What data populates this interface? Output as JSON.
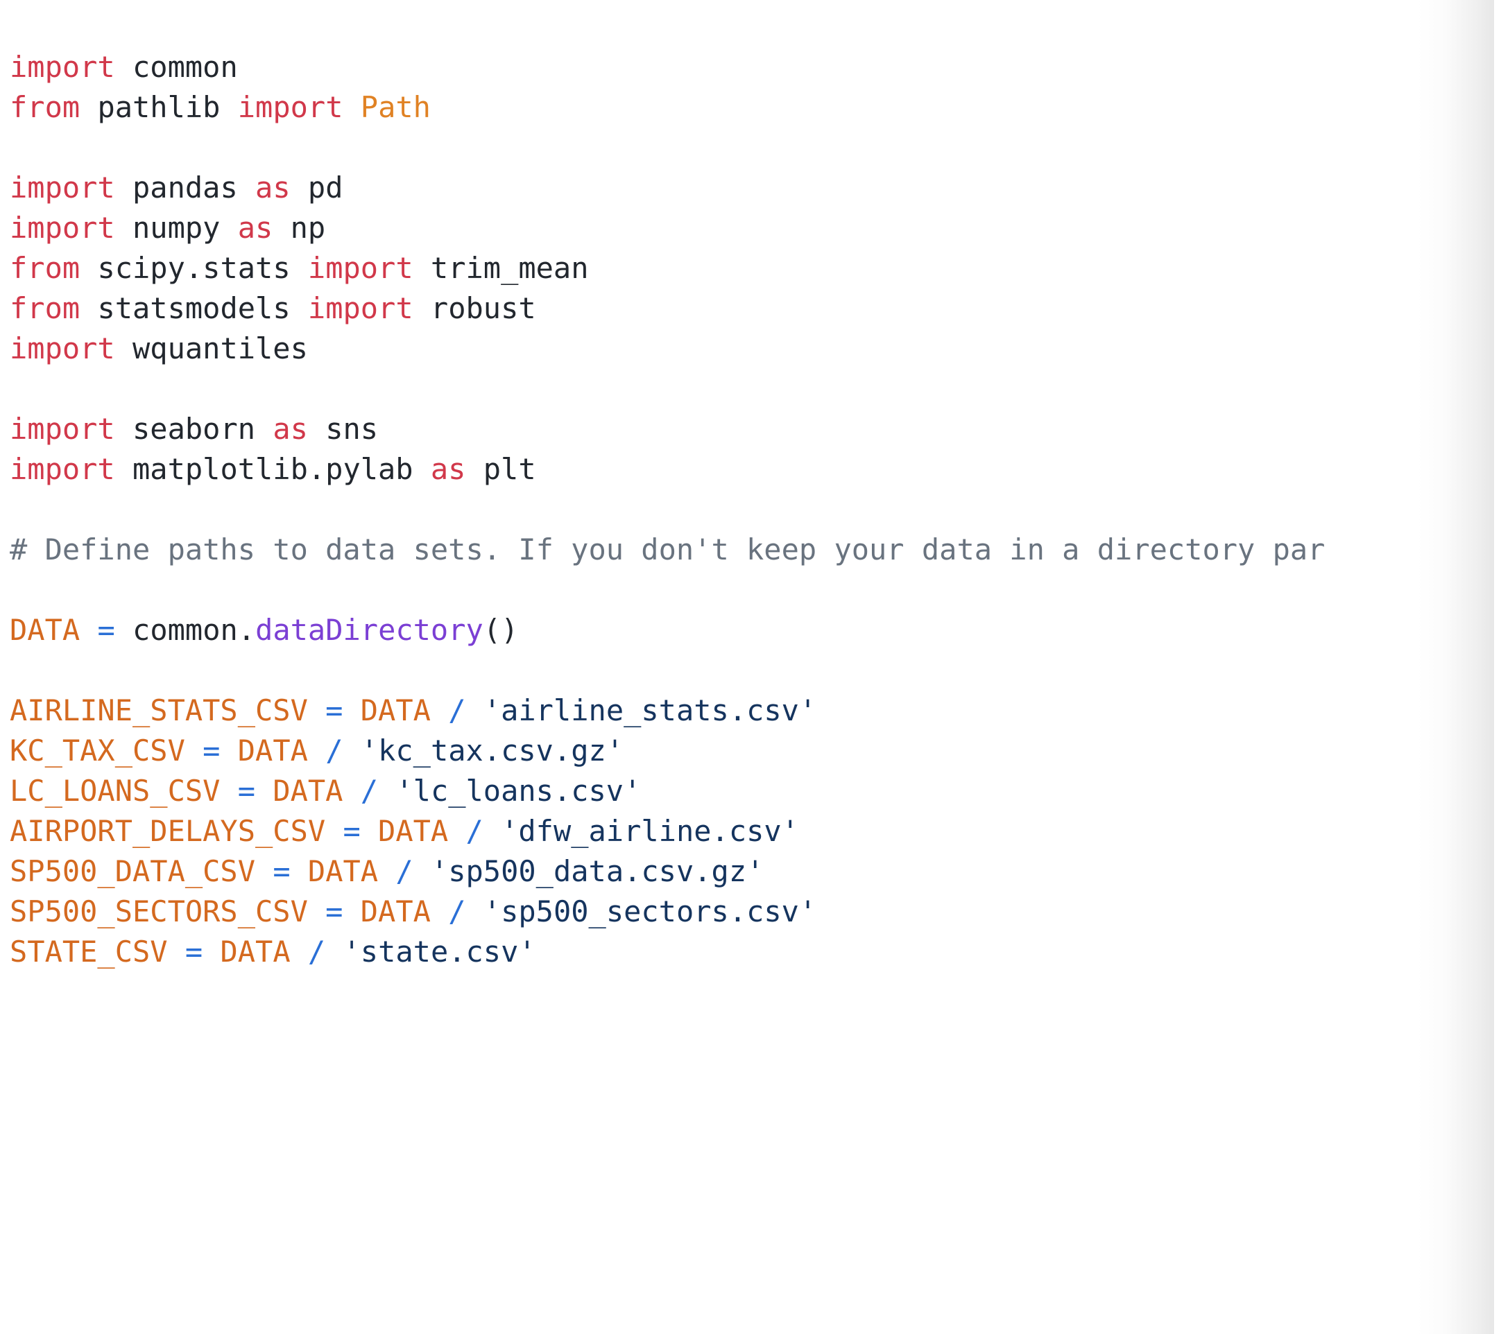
{
  "editor": {
    "language": "python",
    "background": "#ffffff",
    "font_size_px": 42,
    "line_height_px": 58,
    "colors": {
      "keyword": "#d1384a",
      "name": "#22272e",
      "class": "#e08224",
      "constant": "#d4691f",
      "operator": "#2a6fd6",
      "function": "#7b3fd4",
      "string": "#15345e",
      "comment": "#69737f"
    }
  },
  "code": {
    "lines": [
      {
        "id": 1,
        "text": "import common",
        "tokens": [
          {
            "t": "import",
            "c": "kw"
          },
          {
            "t": " ",
            "c": "ws"
          },
          {
            "t": "common",
            "c": "name"
          }
        ]
      },
      {
        "id": 2,
        "text": "from pathlib import Path",
        "tokens": [
          {
            "t": "from",
            "c": "kw"
          },
          {
            "t": " ",
            "c": "ws"
          },
          {
            "t": "pathlib",
            "c": "name"
          },
          {
            "t": " ",
            "c": "ws"
          },
          {
            "t": "import",
            "c": "kw"
          },
          {
            "t": " ",
            "c": "ws"
          },
          {
            "t": "Path",
            "c": "cls"
          }
        ]
      },
      {
        "id": 3,
        "text": "",
        "tokens": []
      },
      {
        "id": 4,
        "text": "import pandas as pd",
        "tokens": [
          {
            "t": "import",
            "c": "kw"
          },
          {
            "t": " ",
            "c": "ws"
          },
          {
            "t": "pandas",
            "c": "name"
          },
          {
            "t": " ",
            "c": "ws"
          },
          {
            "t": "as",
            "c": "kw"
          },
          {
            "t": " ",
            "c": "ws"
          },
          {
            "t": "pd",
            "c": "name"
          }
        ]
      },
      {
        "id": 5,
        "text": "import numpy as np",
        "tokens": [
          {
            "t": "import",
            "c": "kw"
          },
          {
            "t": " ",
            "c": "ws"
          },
          {
            "t": "numpy",
            "c": "name"
          },
          {
            "t": " ",
            "c": "ws"
          },
          {
            "t": "as",
            "c": "kw"
          },
          {
            "t": " ",
            "c": "ws"
          },
          {
            "t": "np",
            "c": "name"
          }
        ]
      },
      {
        "id": 6,
        "text": "from scipy.stats import trim_mean",
        "tokens": [
          {
            "t": "from",
            "c": "kw"
          },
          {
            "t": " ",
            "c": "ws"
          },
          {
            "t": "scipy.stats",
            "c": "name"
          },
          {
            "t": " ",
            "c": "ws"
          },
          {
            "t": "import",
            "c": "kw"
          },
          {
            "t": " ",
            "c": "ws"
          },
          {
            "t": "trim_mean",
            "c": "name"
          }
        ]
      },
      {
        "id": 7,
        "text": "from statsmodels import robust",
        "tokens": [
          {
            "t": "from",
            "c": "kw"
          },
          {
            "t": " ",
            "c": "ws"
          },
          {
            "t": "statsmodels",
            "c": "name"
          },
          {
            "t": " ",
            "c": "ws"
          },
          {
            "t": "import",
            "c": "kw"
          },
          {
            "t": " ",
            "c": "ws"
          },
          {
            "t": "robust",
            "c": "name"
          }
        ]
      },
      {
        "id": 8,
        "text": "import wquantiles",
        "tokens": [
          {
            "t": "import",
            "c": "kw"
          },
          {
            "t": " ",
            "c": "ws"
          },
          {
            "t": "wquantiles",
            "c": "name"
          }
        ]
      },
      {
        "id": 9,
        "text": "",
        "tokens": []
      },
      {
        "id": 10,
        "text": "import seaborn as sns",
        "tokens": [
          {
            "t": "import",
            "c": "kw"
          },
          {
            "t": " ",
            "c": "ws"
          },
          {
            "t": "seaborn",
            "c": "name"
          },
          {
            "t": " ",
            "c": "ws"
          },
          {
            "t": "as",
            "c": "kw"
          },
          {
            "t": " ",
            "c": "ws"
          },
          {
            "t": "sns",
            "c": "name"
          }
        ]
      },
      {
        "id": 11,
        "text": "import matplotlib.pylab as plt",
        "tokens": [
          {
            "t": "import",
            "c": "kw"
          },
          {
            "t": " ",
            "c": "ws"
          },
          {
            "t": "matplotlib.pylab",
            "c": "name"
          },
          {
            "t": " ",
            "c": "ws"
          },
          {
            "t": "as",
            "c": "kw"
          },
          {
            "t": " ",
            "c": "ws"
          },
          {
            "t": "plt",
            "c": "name"
          }
        ]
      },
      {
        "id": 12,
        "text": "",
        "tokens": []
      },
      {
        "id": 13,
        "text": "# Define paths to data sets. If you don't keep your data in a directory par",
        "truncated": true,
        "tokens": [
          {
            "t": "# Define paths to data sets. If you don't keep your data in a directory par",
            "c": "com"
          }
        ]
      },
      {
        "id": 14,
        "text": "",
        "tokens": []
      },
      {
        "id": 15,
        "text": "DATA = common.dataDirectory()",
        "tokens": [
          {
            "t": "DATA",
            "c": "const"
          },
          {
            "t": " ",
            "c": "ws"
          },
          {
            "t": "=",
            "c": "op"
          },
          {
            "t": " ",
            "c": "ws"
          },
          {
            "t": "common",
            "c": "name"
          },
          {
            "t": ".",
            "c": "punc"
          },
          {
            "t": "dataDirectory",
            "c": "fn"
          },
          {
            "t": "()",
            "c": "punc"
          }
        ]
      },
      {
        "id": 16,
        "text": "",
        "tokens": []
      },
      {
        "id": 17,
        "text": "AIRLINE_STATS_CSV = DATA / 'airline_stats.csv'",
        "tokens": [
          {
            "t": "AIRLINE_STATS_CSV",
            "c": "const"
          },
          {
            "t": " ",
            "c": "ws"
          },
          {
            "t": "=",
            "c": "op"
          },
          {
            "t": " ",
            "c": "ws"
          },
          {
            "t": "DATA",
            "c": "const"
          },
          {
            "t": " ",
            "c": "ws"
          },
          {
            "t": "/",
            "c": "op"
          },
          {
            "t": " ",
            "c": "ws"
          },
          {
            "t": "'airline_stats.csv'",
            "c": "str"
          }
        ]
      },
      {
        "id": 18,
        "text": "KC_TAX_CSV = DATA / 'kc_tax.csv.gz'",
        "tokens": [
          {
            "t": "KC_TAX_CSV",
            "c": "const"
          },
          {
            "t": " ",
            "c": "ws"
          },
          {
            "t": "=",
            "c": "op"
          },
          {
            "t": " ",
            "c": "ws"
          },
          {
            "t": "DATA",
            "c": "const"
          },
          {
            "t": " ",
            "c": "ws"
          },
          {
            "t": "/",
            "c": "op"
          },
          {
            "t": " ",
            "c": "ws"
          },
          {
            "t": "'kc_tax.csv.gz'",
            "c": "str"
          }
        ]
      },
      {
        "id": 19,
        "text": "LC_LOANS_CSV = DATA / 'lc_loans.csv'",
        "tokens": [
          {
            "t": "LC_LOANS_CSV",
            "c": "const"
          },
          {
            "t": " ",
            "c": "ws"
          },
          {
            "t": "=",
            "c": "op"
          },
          {
            "t": " ",
            "c": "ws"
          },
          {
            "t": "DATA",
            "c": "const"
          },
          {
            "t": " ",
            "c": "ws"
          },
          {
            "t": "/",
            "c": "op"
          },
          {
            "t": " ",
            "c": "ws"
          },
          {
            "t": "'lc_loans.csv'",
            "c": "str"
          }
        ]
      },
      {
        "id": 20,
        "text": "AIRPORT_DELAYS_CSV = DATA / 'dfw_airline.csv'",
        "tokens": [
          {
            "t": "AIRPORT_DELAYS_CSV",
            "c": "const"
          },
          {
            "t": " ",
            "c": "ws"
          },
          {
            "t": "=",
            "c": "op"
          },
          {
            "t": " ",
            "c": "ws"
          },
          {
            "t": "DATA",
            "c": "const"
          },
          {
            "t": " ",
            "c": "ws"
          },
          {
            "t": "/",
            "c": "op"
          },
          {
            "t": " ",
            "c": "ws"
          },
          {
            "t": "'dfw_airline.csv'",
            "c": "str"
          }
        ]
      },
      {
        "id": 21,
        "text": "SP500_DATA_CSV = DATA / 'sp500_data.csv.gz'",
        "tokens": [
          {
            "t": "SP500_DATA_CSV",
            "c": "const"
          },
          {
            "t": " ",
            "c": "ws"
          },
          {
            "t": "=",
            "c": "op"
          },
          {
            "t": " ",
            "c": "ws"
          },
          {
            "t": "DATA",
            "c": "const"
          },
          {
            "t": " ",
            "c": "ws"
          },
          {
            "t": "/",
            "c": "op"
          },
          {
            "t": " ",
            "c": "ws"
          },
          {
            "t": "'sp500_data.csv.gz'",
            "c": "str"
          }
        ]
      },
      {
        "id": 22,
        "text": "SP500_SECTORS_CSV = DATA / 'sp500_sectors.csv'",
        "tokens": [
          {
            "t": "SP500_SECTORS_CSV",
            "c": "const"
          },
          {
            "t": " ",
            "c": "ws"
          },
          {
            "t": "=",
            "c": "op"
          },
          {
            "t": " ",
            "c": "ws"
          },
          {
            "t": "DATA",
            "c": "const"
          },
          {
            "t": " ",
            "c": "ws"
          },
          {
            "t": "/",
            "c": "op"
          },
          {
            "t": " ",
            "c": "ws"
          },
          {
            "t": "'sp500_sectors.csv'",
            "c": "str"
          }
        ]
      },
      {
        "id": 23,
        "text": "STATE_CSV = DATA / 'state.csv'",
        "tokens": [
          {
            "t": "STATE_CSV",
            "c": "const"
          },
          {
            "t": " ",
            "c": "ws"
          },
          {
            "t": "=",
            "c": "op"
          },
          {
            "t": " ",
            "c": "ws"
          },
          {
            "t": "DATA",
            "c": "const"
          },
          {
            "t": " ",
            "c": "ws"
          },
          {
            "t": "/",
            "c": "op"
          },
          {
            "t": " ",
            "c": "ws"
          },
          {
            "t": "'state.csv'",
            "c": "str"
          }
        ]
      }
    ]
  }
}
